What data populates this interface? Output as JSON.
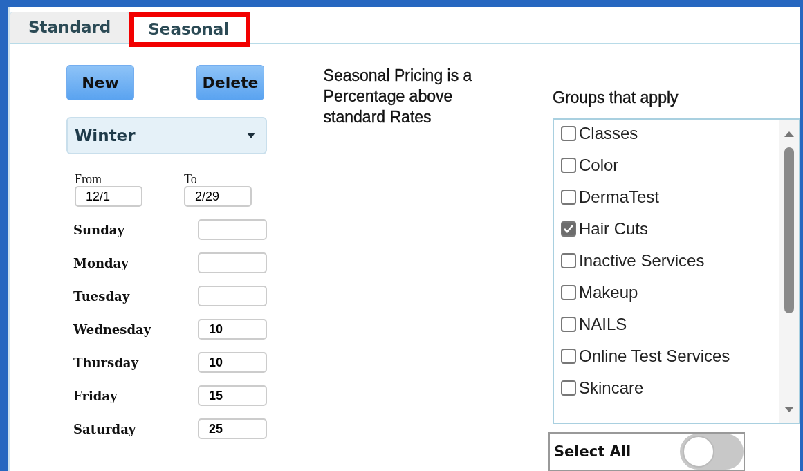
{
  "tabs": [
    {
      "label": "Standard",
      "selected": false,
      "highlighted": false
    },
    {
      "label": "Seasonal",
      "selected": true,
      "highlighted": true
    }
  ],
  "buttons": [
    "New",
    "Delete"
  ],
  "season_dropdown": {
    "value": "Winter"
  },
  "date_range": [
    {
      "label": "From",
      "value": "12/1"
    },
    {
      "label": "To",
      "value": "2/29"
    }
  ],
  "days": [
    {
      "label": "Sunday"
    },
    {
      "label": "Monday"
    },
    {
      "label": "Tuesday"
    },
    {
      "label": "Wednesday",
      "value": "10"
    },
    {
      "label": "Thursday",
      "value": "10"
    },
    {
      "label": "Friday",
      "value": "15"
    },
    {
      "label": "Saturday",
      "value": "25"
    }
  ],
  "note": "Seasonal Pricing is a Percentage above standard Rates",
  "groups": {
    "title": "Groups that apply",
    "items": [
      {
        "label": "Classes",
        "checked": false
      },
      {
        "label": "Color",
        "checked": false
      },
      {
        "label": "DermaTest",
        "checked": false
      },
      {
        "label": "Hair Cuts",
        "checked": true
      },
      {
        "label": "Inactive Services",
        "checked": false
      },
      {
        "label": "Makeup",
        "checked": false
      },
      {
        "label": "NAILS",
        "checked": false
      },
      {
        "label": "Online Test Services",
        "checked": false
      },
      {
        "label": "Skincare",
        "checked": false
      }
    ]
  },
  "select_all": {
    "label": "Select All",
    "on": false
  }
}
